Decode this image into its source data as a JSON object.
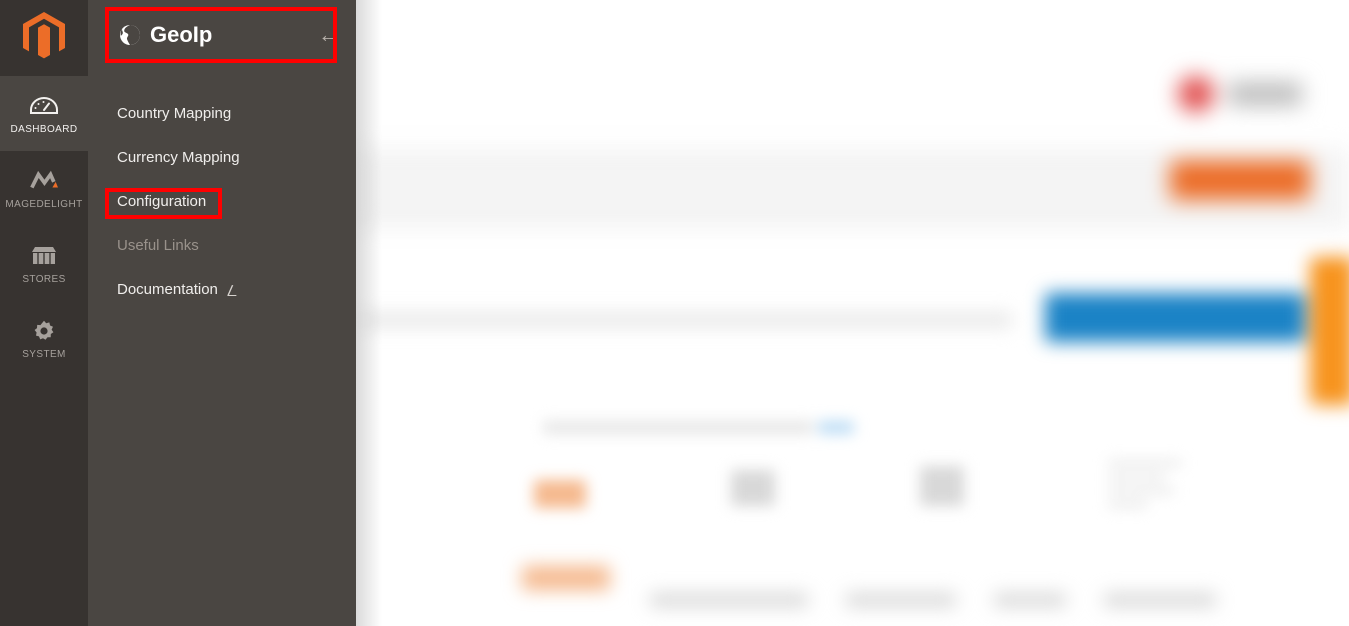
{
  "app": {
    "name": "Magento Admin",
    "logo_icon": "magento-logo-icon",
    "accent_orange": "#ec6d28",
    "accent_blue": "#1b83c6",
    "highlight_red": "#ff0000",
    "rail_bg": "#373330",
    "panel_bg": "#4a4642"
  },
  "rail": {
    "items": [
      {
        "label": "DASHBOARD",
        "icon": "dashboard-gauge-icon",
        "active": true
      },
      {
        "label": "MAGEDELIGHT",
        "icon": "magedelight-icon",
        "active": false
      },
      {
        "label": "STORES",
        "icon": "store-icon",
        "active": false
      },
      {
        "label": "SYSTEM",
        "icon": "gear-icon",
        "active": false
      }
    ]
  },
  "panel": {
    "title": "GeoIp",
    "title_icon": "globe-icon",
    "back_icon": "arrow-left-icon",
    "items": [
      {
        "label": "Country Mapping",
        "type": "link",
        "highlighted": false,
        "external": false
      },
      {
        "label": "Currency Mapping",
        "type": "link",
        "highlighted": false,
        "external": false
      },
      {
        "label": "Configuration",
        "type": "link",
        "highlighted": true,
        "external": false
      },
      {
        "label": "Useful Links",
        "type": "heading",
        "highlighted": false,
        "external": false
      },
      {
        "label": "Documentation",
        "type": "link",
        "highlighted": false,
        "external": true,
        "external_icon": "external-link-icon"
      }
    ]
  },
  "highlights": [
    {
      "target": "panel-header",
      "color": "#ff0000"
    },
    {
      "target": "configuration",
      "color": "#ff0000"
    }
  ],
  "content": {
    "state": "blurred",
    "note": "Background admin page is blurred out; no legible text is rendered."
  }
}
